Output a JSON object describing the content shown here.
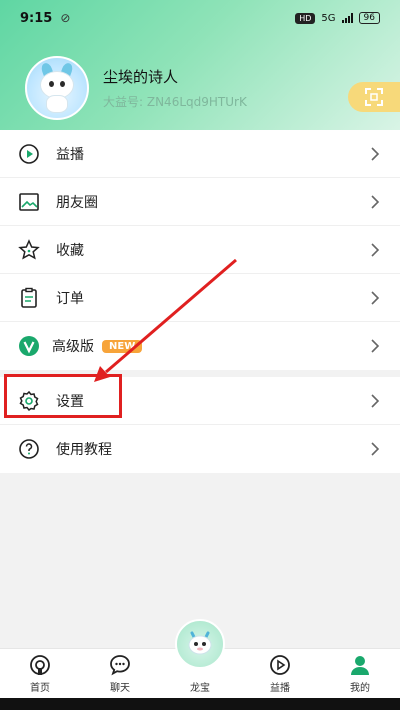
{
  "status_bar": {
    "time": "9:15",
    "extra": "⊘",
    "network": "5G",
    "battery": "96"
  },
  "profile": {
    "username": "尘埃的诗人",
    "user_id": "大益号: ZN46Lqd9HTUrK"
  },
  "menu": [
    {
      "key": "yibo",
      "label": "益播",
      "icon": "play-circle-icon"
    },
    {
      "key": "moments",
      "label": "朋友圈",
      "icon": "image-icon"
    },
    {
      "key": "favorites",
      "label": "收藏",
      "icon": "star-icon"
    },
    {
      "key": "orders",
      "label": "订单",
      "icon": "clipboard-icon"
    },
    {
      "key": "premium",
      "label": "高级版",
      "icon": "v-badge-icon",
      "badge": "NEW"
    }
  ],
  "menu2": [
    {
      "key": "settings",
      "label": "设置",
      "icon": "gear-icon"
    },
    {
      "key": "tutorial",
      "label": "使用教程",
      "icon": "help-icon"
    }
  ],
  "bottom_nav": [
    {
      "key": "home",
      "label": "首页"
    },
    {
      "key": "chat",
      "label": "聊天"
    },
    {
      "key": "longbao",
      "label": "龙宝"
    },
    {
      "key": "yibo",
      "label": "益播"
    },
    {
      "key": "mine",
      "label": "我的"
    }
  ],
  "colors": {
    "accent": "#1aa86c",
    "highlight": "#e02020",
    "badge": "#f7a43a"
  }
}
